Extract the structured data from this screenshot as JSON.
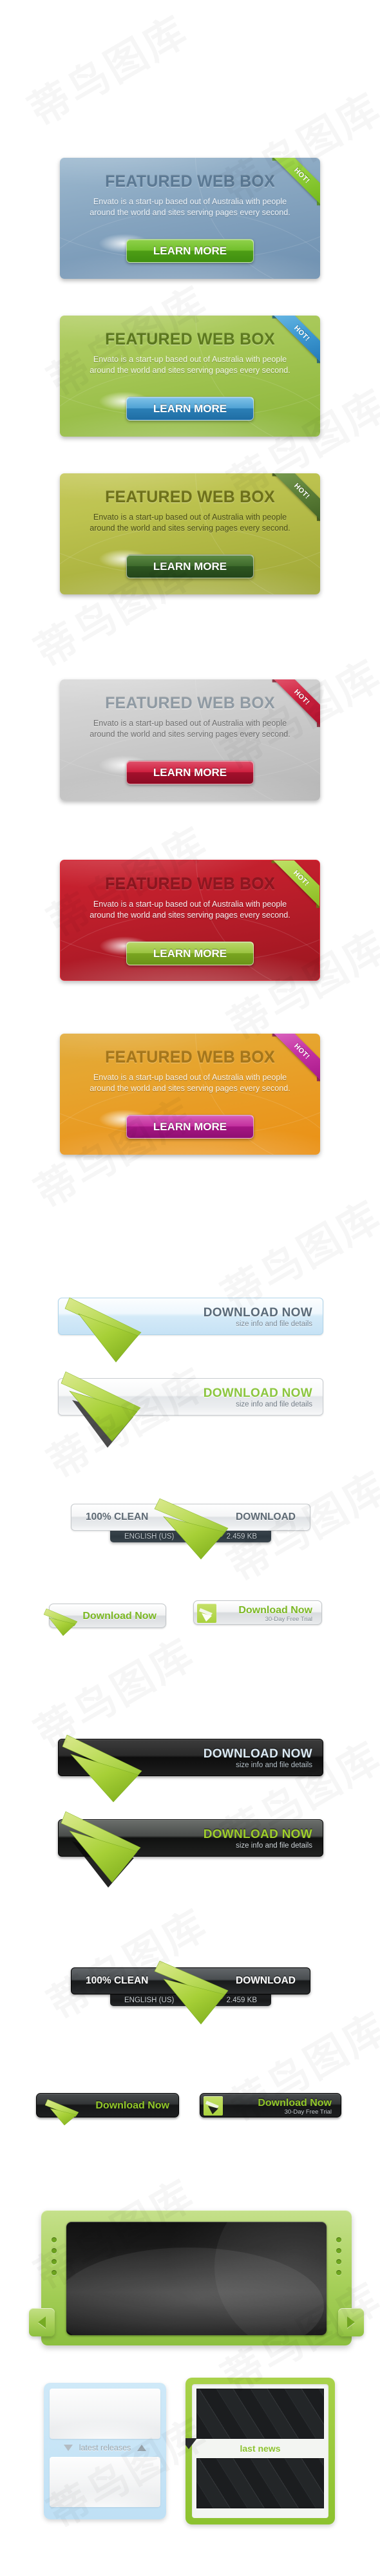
{
  "featured_boxes": [
    {
      "theme": "blue",
      "title": "FEATURED WEB BOX",
      "body": "Envato is a start-up based out of Australia with people around the world and sites serving pages every second.",
      "button_label": "LEARN MORE",
      "ribbon_label": "HOT!",
      "box_color": "#7a9ab8",
      "button_color": "#6ab32a",
      "ribbon_color": "#8dcc37"
    },
    {
      "theme": "green",
      "title": "FEATURED WEB BOX",
      "body": "Envato is a start-up based out of Australia with people around the world and sites serving pages every second.",
      "button_label": "LEARN MORE",
      "ribbon_label": "HOT!",
      "box_color": "#9fc24c",
      "button_color": "#3f95c8",
      "ribbon_color": "#3f9ad3"
    },
    {
      "theme": "olive",
      "title": "FEATURED WEB BOX",
      "body": "Envato is a start-up based out of Australia with people around the world and sites serving pages every second.",
      "button_label": "LEARN MORE",
      "ribbon_label": "HOT!",
      "box_color": "#b6bc49",
      "button_color": "#3a6429",
      "ribbon_color": "#5d8039"
    },
    {
      "theme": "gray",
      "title": "FEATURED WEB BOX",
      "body": "Envato is a start-up based out of Australia with people around the world and sites serving pages every second.",
      "button_label": "LEARN MORE",
      "ribbon_label": "HOT!",
      "box_color": "#c9c9c9",
      "button_color": "#c51f3c",
      "ribbon_color": "#cf2240"
    },
    {
      "theme": "red",
      "title": "FEATURED WEB BOX",
      "body": "Envato is a start-up based out of Australia with people around the world and sites serving pages every second.",
      "button_label": "LEARN MORE",
      "ribbon_label": "HOT!",
      "box_color": "#bb1d29",
      "button_color": "#93bb2e",
      "ribbon_color": "#a7d241"
    },
    {
      "theme": "orange",
      "title": "FEATURED WEB BOX",
      "body": "Envato is a start-up based out of Australia with people around the world and sites serving pages every second.",
      "button_label": "LEARN MORE",
      "ribbon_label": "HOT!",
      "box_color": "#e59c26",
      "button_color": "#b92a94",
      "ribbon_color": "#c533a4"
    }
  ],
  "download_buttons": {
    "light_wide": {
      "main": "DOWNLOAD NOW",
      "sub": "size info and file details",
      "icon": "download-arrow-icon"
    },
    "silver_wide": {
      "main": "DOWNLOAD NOW",
      "sub": "size info and file details",
      "icon": "download-arrow-icon"
    },
    "light_split": {
      "left": "100% CLEAN",
      "right": "DOWNLOAD",
      "sub_left": "ENGLISH (US)",
      "sub_right": "2.459 KB",
      "icon": "download-arrow-icon"
    },
    "light_pill_a": {
      "main": "Download Now",
      "icon": "download-arrow-icon"
    },
    "light_pill_b": {
      "main": "Download Now",
      "sub": "30-Day Free Trial",
      "icon": "download-arrow-icon"
    },
    "dark_wide": {
      "main": "DOWNLOAD NOW",
      "sub": "size info and file details",
      "icon": "download-arrow-icon"
    },
    "darkgreen_wide": {
      "main": "DOWNLOAD NOW",
      "sub": "size info and file details",
      "icon": "download-arrow-icon"
    },
    "dark_split": {
      "left": "100% CLEAN",
      "right": "DOWNLOAD",
      "sub_left": "ENGLISH (US)",
      "sub_right": "2.459 KB",
      "icon": "download-arrow-icon"
    },
    "dark_pill_a": {
      "main": "Download Now",
      "icon": "download-arrow-icon"
    },
    "dark_pill_b": {
      "main": "Download Now",
      "sub": "30-Day Free Trial",
      "icon": "download-arrow-icon"
    }
  },
  "media_frame": {
    "prev_icon": "arrow-left-icon",
    "next_icon": "arrow-right-icon",
    "frame_color": "#a9d15c",
    "screen_color": "#1a1a1a"
  },
  "bottom_panels": {
    "blue": {
      "caption": "latest releases",
      "collapse_icon": "triangle-down-icon",
      "expand_icon": "triangle-up-icon",
      "frame_color": "#bfe0f5"
    },
    "green": {
      "caption": "last news",
      "marker_icon": "triangle-down-icon",
      "frame_color": "#8cc22f"
    }
  },
  "watermark": {
    "text": "蒂鸟图库"
  }
}
